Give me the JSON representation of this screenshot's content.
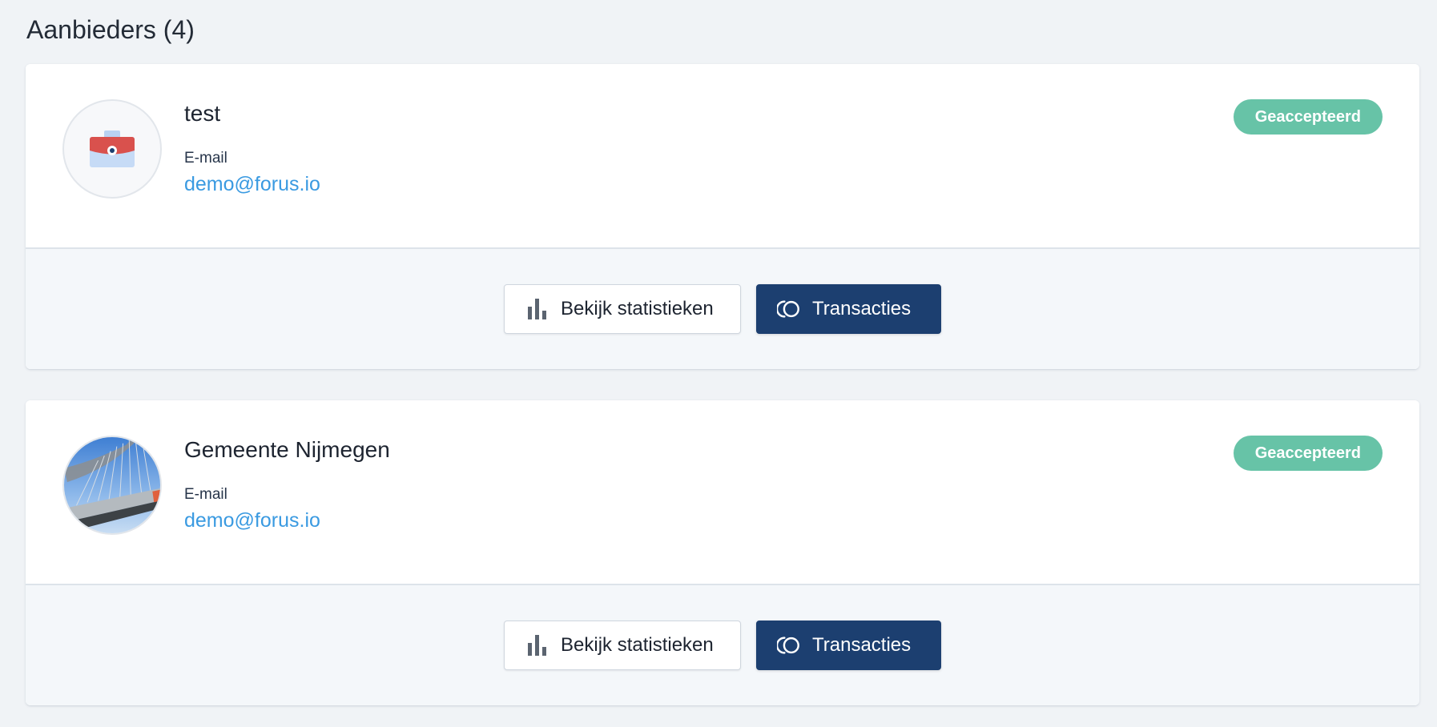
{
  "page": {
    "title": "Aanbieders (4)"
  },
  "providers": [
    {
      "name": "test",
      "email_label": "E-mail",
      "email": "demo@forus.io",
      "status": "Geaccepteerd",
      "avatar": "briefcase-icon",
      "stats_button": "Bekijk statistieken",
      "transactions_button": "Transacties"
    },
    {
      "name": "Gemeente Nijmegen",
      "email_label": "E-mail",
      "email": "demo@forus.io",
      "status": "Geaccepteerd",
      "avatar": "bridge-photo",
      "stats_button": "Bekijk statistieken",
      "transactions_button": "Transacties"
    }
  ],
  "icons": {
    "stats": "bar-chart-icon",
    "transactions": "coins-icon"
  },
  "colors": {
    "status_accepted": "#67c3a7",
    "primary_button": "#1c3f70",
    "link": "#3a9ae1",
    "page_background": "#f0f3f6"
  }
}
